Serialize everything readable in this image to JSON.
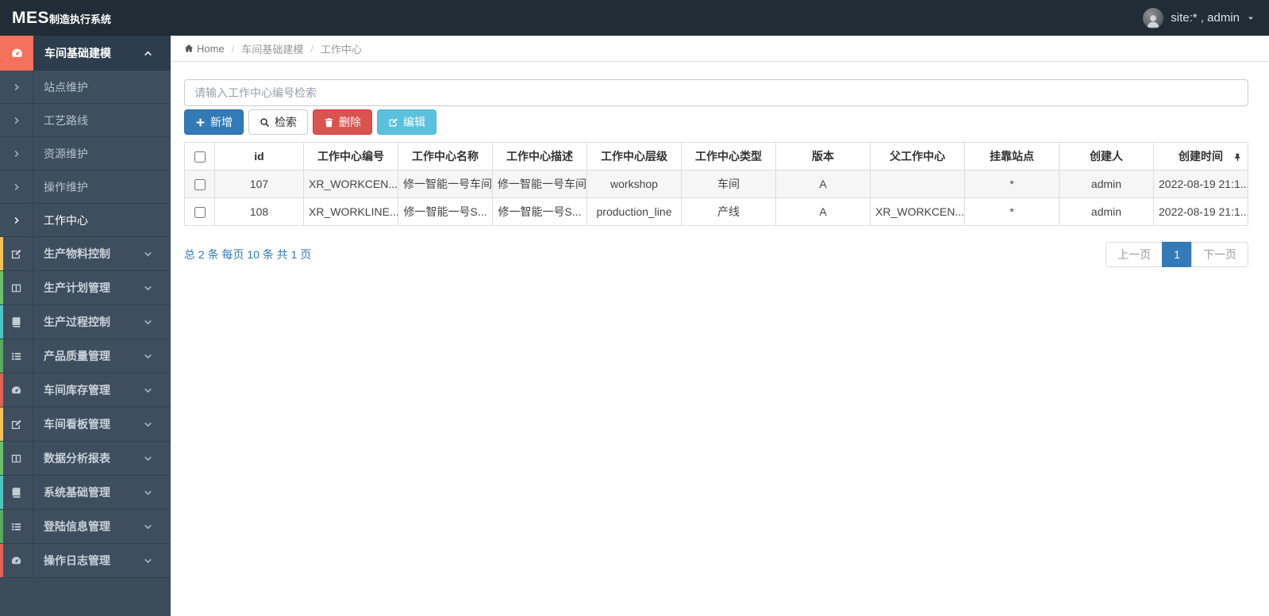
{
  "topbar": {
    "logo_bold": "MES",
    "logo_rest": "制造执行系统",
    "user_label": "site:* , admin",
    "avatar_icon": "user-icon",
    "caret_icon": "caret-down-icon",
    "background": "#222c36"
  },
  "sidebar": {
    "background": "#3b4b5a",
    "active_group": {
      "label": "车间基础建模",
      "icon": "dashboard-icon",
      "icon_background": "#f4715c",
      "caret_icon": "chevron-up-icon"
    },
    "submenu": [
      {
        "label": "站点维护",
        "icon": "chevron-right-icon",
        "active": false
      },
      {
        "label": "工艺路线",
        "icon": "chevron-right-icon",
        "active": false
      },
      {
        "label": "资源维护",
        "icon": "chevron-right-icon",
        "active": false
      },
      {
        "label": "操作维护",
        "icon": "chevron-right-icon",
        "active": false
      },
      {
        "label": "工作中心",
        "icon": "chevron-right-icon",
        "active": true
      }
    ],
    "items": [
      {
        "label": "生产物料控制",
        "icon": "edit-icon",
        "stripe": "#f3c35b",
        "caret_icon": "chevron-down-icon"
      },
      {
        "label": "生产计划管理",
        "icon": "columns-icon",
        "stripe": "#6cbf6c",
        "caret_icon": "chevron-down-icon"
      },
      {
        "label": "生产过程控制",
        "icon": "book-icon",
        "stripe": "#4fc3c0",
        "caret_icon": "chevron-down-icon"
      },
      {
        "label": "产品质量管理",
        "icon": "list-icon",
        "stripe": "#5aa860",
        "caret_icon": "chevron-down-icon"
      },
      {
        "label": "车间库存管理",
        "icon": "dashboard-icon",
        "stripe": "#e06158",
        "caret_icon": "chevron-down-icon"
      },
      {
        "label": "车间看板管理",
        "icon": "edit-icon",
        "stripe": "#f3c35b",
        "caret_icon": "chevron-down-icon"
      },
      {
        "label": "数据分析报表",
        "icon": "columns-icon",
        "stripe": "#6cbf6c",
        "caret_icon": "chevron-down-icon"
      },
      {
        "label": "系统基础管理",
        "icon": "book-icon",
        "stripe": "#4fc3c0",
        "caret_icon": "chevron-down-icon"
      },
      {
        "label": "登陆信息管理",
        "icon": "list-icon",
        "stripe": "#5aa860",
        "caret_icon": "chevron-down-icon"
      },
      {
        "label": "操作日志管理",
        "icon": "dashboard-icon",
        "stripe": "#e06158",
        "caret_icon": "chevron-down-icon"
      }
    ]
  },
  "breadcrumb": {
    "home_icon": "home-icon",
    "home": "Home",
    "separator": "/",
    "items": [
      "车间基础建模",
      "工作中心"
    ]
  },
  "toolbar": {
    "search_placeholder": "请输入工作中心编号检索",
    "search_value": "",
    "add_label": "新增",
    "search_label": "检索",
    "delete_label": "删除",
    "edit_label": "编辑",
    "add_icon": "plus-icon",
    "search_icon": "search-icon",
    "delete_icon": "trash-icon",
    "edit_icon": "edit-icon",
    "colors": {
      "primary": "#337ab7",
      "default": "#ffffff",
      "danger": "#d9534f",
      "info": "#5bc0de"
    }
  },
  "table": {
    "columns": [
      "id",
      "工作中心编号",
      "工作中心名称",
      "工作中心描述",
      "工作中心层级",
      "工作中心类型",
      "版本",
      "父工作中心",
      "挂靠站点",
      "创建人",
      "创建时间"
    ],
    "pin_icon": "pin-icon",
    "rows": [
      {
        "cells": [
          "107",
          "XR_WORKCEN...",
          "修一智能一号车间",
          "修一智能一号车间",
          "workshop",
          "车间",
          "A",
          "",
          "*",
          "admin",
          "2022-08-19 21:1..."
        ]
      },
      {
        "cells": [
          "108",
          "XR_WORKLINE...",
          "修一智能一号S...",
          "修一智能一号S...",
          "production_line",
          "产线",
          "A",
          "XR_WORKCEN...",
          "*",
          "admin",
          "2022-08-19 21:1..."
        ]
      }
    ]
  },
  "pagination": {
    "summary": "总 2 条 每页 10 条 共 1 页",
    "prev_label": "上一页",
    "current_page": "1",
    "next_label": "下一页",
    "active_color": "#337ab7"
  }
}
